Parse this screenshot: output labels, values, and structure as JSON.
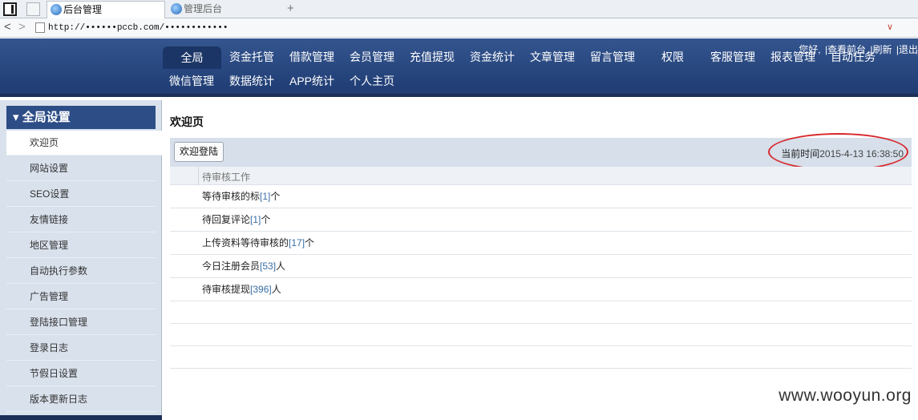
{
  "browser": {
    "tabs": [
      {
        "label": "后台管理"
      },
      {
        "label": "管理后台"
      }
    ],
    "new_tab": "+",
    "address": "http://••••••pccb.com/••••••••••••",
    "back": "<",
    "forward": ">"
  },
  "header": {
    "menu_row1": [
      "全局",
      "资金托管",
      "借款管理",
      "会员管理",
      "充值提现",
      "资金统计",
      "文章管理",
      "留言管理",
      "权限",
      "客服管理",
      "报表管理",
      "自动任务"
    ],
    "menu_row2": [
      "微信管理",
      "数据统计",
      "APP统计",
      "个人主页"
    ],
    "links": [
      "您好,",
      "|查看前台",
      "|刷新",
      "|退出"
    ]
  },
  "sidebar": {
    "title": "全局设置",
    "items": [
      "欢迎页",
      "网站设置",
      "SEO设置",
      "友情链接",
      "地区管理",
      "自动执行参数",
      "广告管理",
      "登陆接口管理",
      "登录日志",
      "节假日设置",
      "版本更新日志"
    ]
  },
  "main": {
    "title": "欢迎页",
    "button": "欢迎登陆",
    "time_label": "当前时间",
    "time_value": "2015-4-13 16:38:50",
    "table_header": "待审核工作",
    "rows": [
      {
        "pre": "等待审核的标",
        "num": "[1]",
        "post": "个"
      },
      {
        "pre": "待回复评论",
        "num": "[1]",
        "post": "个"
      },
      {
        "pre": "上传资料等待审核的",
        "num": "[17]",
        "post": "个"
      },
      {
        "pre": "今日注册会员",
        "num": "[53]",
        "post": "人"
      },
      {
        "pre": "待审核提现",
        "num": "[396]",
        "post": "人"
      }
    ]
  },
  "watermark": "www.wooyun.org",
  "colors": {
    "header": "#2a4a82",
    "sidebar": "#d9e1ec",
    "highlight_circle": "#d8272b",
    "number": "#3a6ea5"
  }
}
